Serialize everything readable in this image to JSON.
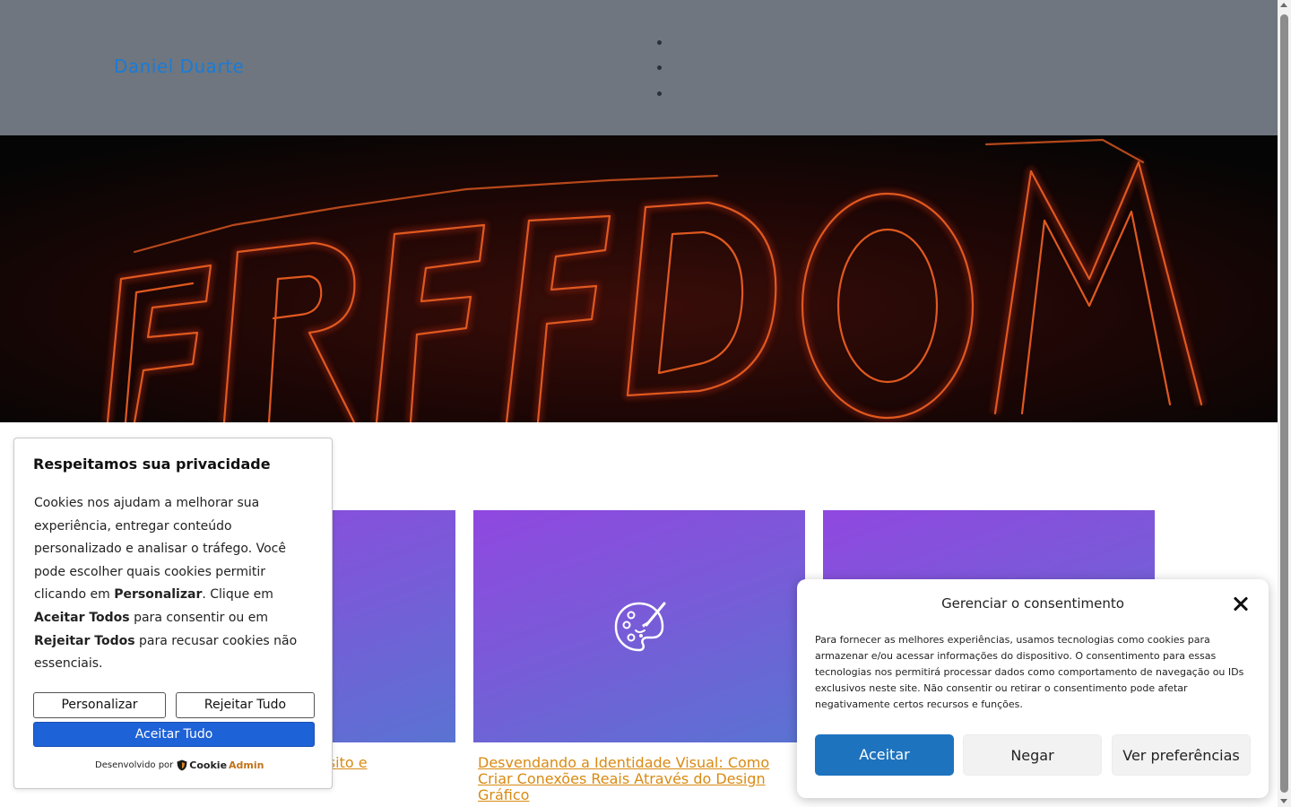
{
  "header": {
    "site_title": "Daniel Duarte",
    "nav_item_count": 3
  },
  "hero": {
    "image_subject": "neon sign",
    "sign_text": "FREEDOM"
  },
  "posts": [
    {
      "title": "Visual no Design com Propósito e Personalidade",
      "icon": "palette-icon"
    },
    {
      "title": "Desvendando a Identidade Visual: Como Criar Conexões Reais Através do Design Gráfico",
      "icon": "palette-icon"
    },
    {
      "title": "",
      "icon": "palette-icon"
    }
  ],
  "cookie_notice": {
    "title": "Respeitamos sua privacidade",
    "body_1": "Cookies nos ajudam a melhorar sua experiência, entregar conteúdo personalizado e analisar o tráfego. Você pode escolher quais cookies permitir clicando em ",
    "bold_personalizar": "Personalizar",
    "body_2": ". Clique em ",
    "bold_aceitar": "Aceitar Todos",
    "body_3": " para consentir ou em ",
    "bold_rejeitar": "Rejeitar Todos",
    "body_4": " para recusar cookies não essenciais.",
    "customize_label": "Personalizar",
    "reject_label": "Rejeitar Tudo",
    "accept_label": "Aceitar Tudo",
    "powered_by": "Desenvolvido por",
    "brand_part1": "Cookie",
    "brand_part2": "Admin",
    "brand_icon": "shield-icon"
  },
  "consent_manager": {
    "title": "Gerenciar o consentimento",
    "text": "Para fornecer as melhores experiências, usamos tecnologias como cookies para armazenar e/ou acessar informações do dispositivo. O consentimento para essas tecnologias nos permitirá processar dados como comportamento de navegação ou IDs exclusivos neste site. Não consentir ou retirar o consentimento pode afetar negativamente certos recursos e funções.",
    "accept_label": "Aceitar",
    "deny_label": "Negar",
    "preferences_label": "Ver preferências",
    "close_icon": "close-icon"
  },
  "colors": {
    "header_bg": "#6f767f",
    "site_title": "#1a7bd6",
    "post_link": "#d98a12",
    "accept_all_blue": "#1e62d8",
    "consent_accept_blue": "#1e73be",
    "neon_orange": "#e0591f"
  }
}
